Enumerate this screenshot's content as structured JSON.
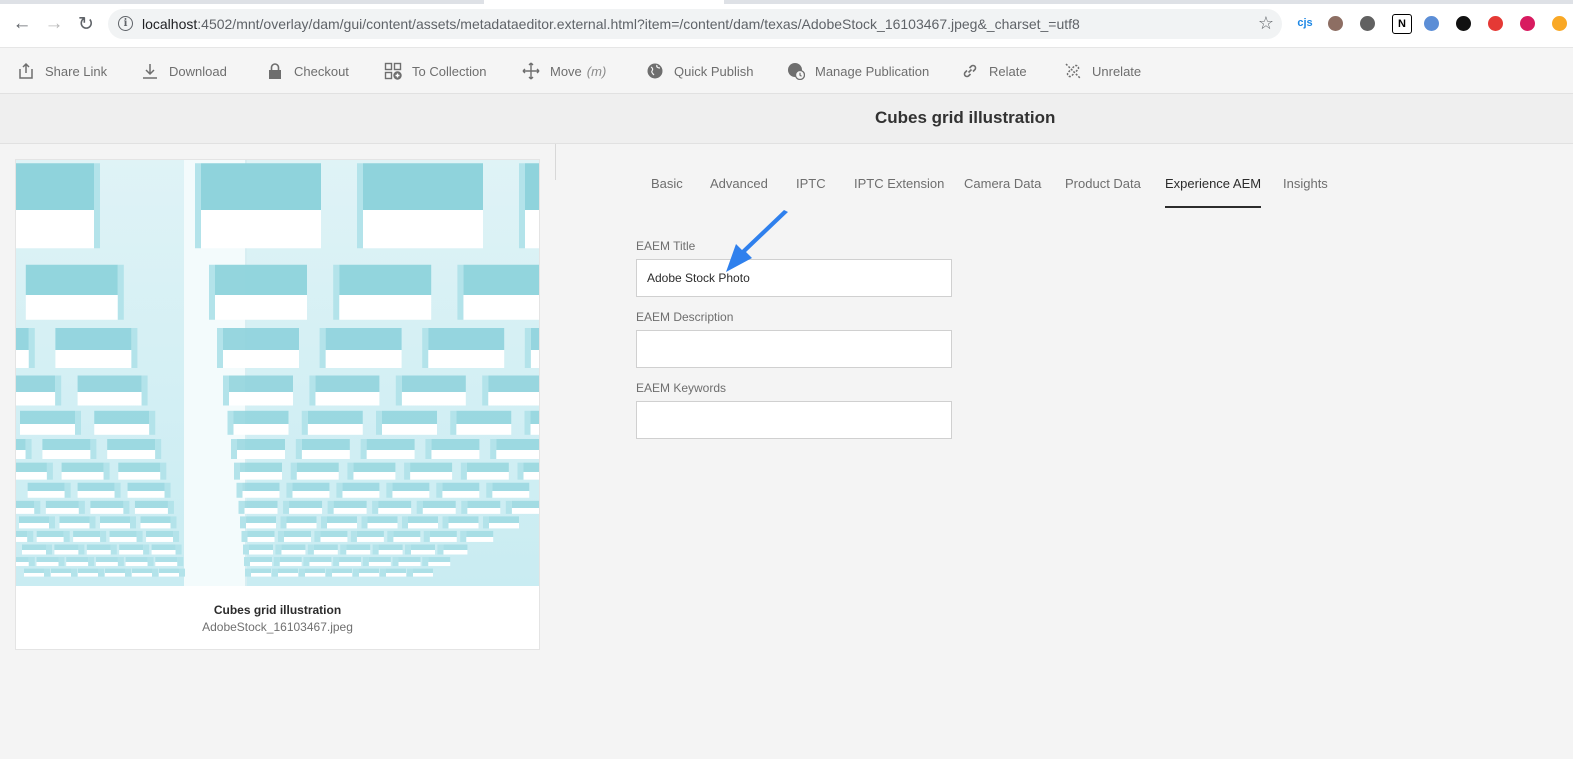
{
  "browser": {
    "url_host": "localhost",
    "url_path": ":4502/mnt/overlay/dam/gui/content/assets/metadataeditor.external.html?item=/content/dam/texas/AdobeStock_16103467.jpeg&_charset_=utf8",
    "extensions": [
      {
        "name": "cjs-extension",
        "label": "cjs",
        "color": "#1e88e5"
      },
      {
        "name": "quill-extension",
        "label": "",
        "color": "#8d6e63"
      },
      {
        "name": "circle-extension",
        "label": "",
        "color": "#616161"
      },
      {
        "name": "n-extension",
        "label": "N",
        "color": "#000000"
      },
      {
        "name": "blue-orb-extension",
        "label": "",
        "color": "#5c8ed6"
      },
      {
        "name": "spy-extension",
        "label": "",
        "color": "#111111"
      },
      {
        "name": "stop-hand-extension",
        "label": "",
        "color": "#e53935"
      },
      {
        "name": "eye-extension",
        "label": "",
        "color": "#d81b60"
      },
      {
        "name": "triangle-extension",
        "label": "",
        "color": "#f9a825"
      }
    ]
  },
  "toolbar": {
    "items": [
      {
        "label": "Share Link",
        "icon": "share-icon"
      },
      {
        "label": "Download",
        "icon": "download-icon"
      },
      {
        "label": "Checkout",
        "icon": "lock-icon"
      },
      {
        "label": "To Collection",
        "icon": "collection-add-icon"
      },
      {
        "label": "Move",
        "hint": "(m)",
        "icon": "move-icon"
      },
      {
        "label": "Quick Publish",
        "icon": "globe-icon"
      },
      {
        "label": "Manage Publication",
        "icon": "globe-clock-icon"
      },
      {
        "label": "Relate",
        "icon": "link-icon"
      },
      {
        "label": "Unrelate",
        "icon": "unlink-icon"
      }
    ]
  },
  "page": {
    "title": "Cubes grid illustration"
  },
  "card": {
    "title": "Cubes grid illustration",
    "filename": "AdobeStock_16103467.jpeg"
  },
  "tabs": [
    {
      "label": "Basic",
      "active": false
    },
    {
      "label": "Advanced",
      "active": false
    },
    {
      "label": "IPTC",
      "active": false
    },
    {
      "label": "IPTC Extension",
      "active": false
    },
    {
      "label": "Camera Data",
      "active": false
    },
    {
      "label": "Product Data",
      "active": false
    },
    {
      "label": "Experience AEM",
      "active": true
    },
    {
      "label": "Insights",
      "active": false
    }
  ],
  "fields": {
    "title": {
      "label": "EAEM Title",
      "value": "Adobe Stock Photo"
    },
    "description": {
      "label": "EAEM Description",
      "value": ""
    },
    "keywords": {
      "label": "EAEM Keywords",
      "value": ""
    }
  },
  "colors": {
    "annotation_arrow": "#2f80ed",
    "cube_face_light": "#ffffff",
    "cube_face_blue": "#8fd3dc"
  }
}
